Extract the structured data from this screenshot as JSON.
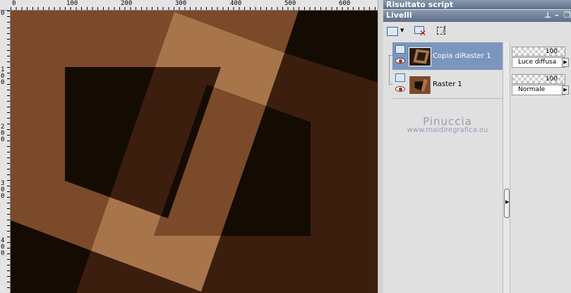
{
  "ruler": {
    "top_labels": [
      "0",
      "100",
      "200",
      "300",
      "400",
      "500",
      "600"
    ],
    "left_labels": [
      "0",
      "1\n0\n0",
      "2\n0\n0",
      "3\n0\n0",
      "4\n0\n0"
    ]
  },
  "canvas": {
    "colors": {
      "base": "#7b4a2a",
      "light": "#a8754b",
      "dark": "#140b03",
      "deep": "#3c1e0e"
    }
  },
  "panels": {
    "script_title": "Risultato script",
    "layers_title": "Livelli",
    "layers": [
      {
        "name": "Copia diRaster 1",
        "opacity": "100",
        "blend": "Luce diffusa",
        "selected": true
      },
      {
        "name": "Raster 1",
        "opacity": "100",
        "blend": "Normale",
        "selected": false
      }
    ],
    "watermark": {
      "name": "Pinuccia",
      "url": "www.maidiregrafica.eu"
    },
    "selected_color": "#7b96bd"
  }
}
